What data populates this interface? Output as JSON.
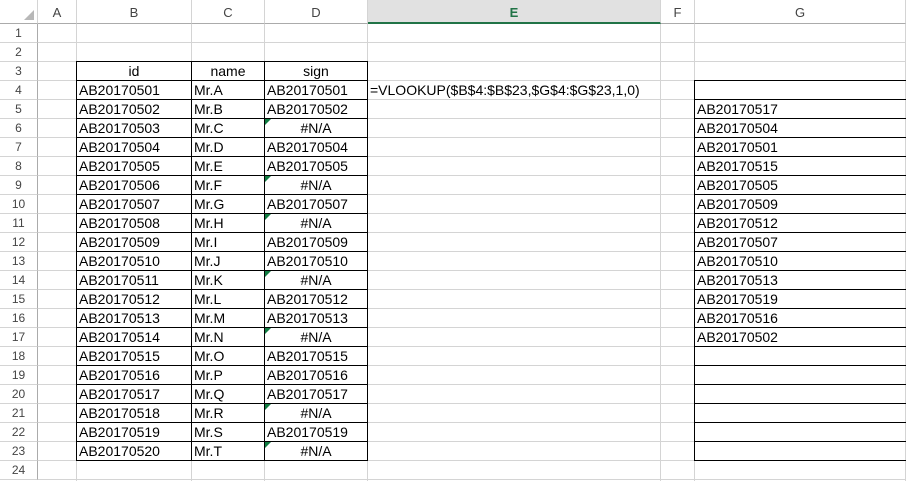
{
  "columns": [
    "A",
    "B",
    "C",
    "D",
    "E",
    "F",
    "G"
  ],
  "active_column": "E",
  "rows": [
    "1",
    "2",
    "3",
    "4",
    "5",
    "6",
    "7",
    "8",
    "9",
    "10",
    "11",
    "12",
    "13",
    "14",
    "15",
    "16",
    "17",
    "18",
    "19",
    "20",
    "21",
    "22",
    "23",
    "24"
  ],
  "table": {
    "headers": {
      "id": "id",
      "name": "name",
      "sign": "sign"
    },
    "data": [
      {
        "id": "AB20170501",
        "name": "Mr.A",
        "sign": "AB20170501",
        "err": false
      },
      {
        "id": "AB20170502",
        "name": "Mr.B",
        "sign": "AB20170502",
        "err": false
      },
      {
        "id": "AB20170503",
        "name": "Mr.C",
        "sign": "#N/A",
        "err": true
      },
      {
        "id": "AB20170504",
        "name": "Mr.D",
        "sign": "AB20170504",
        "err": false
      },
      {
        "id": "AB20170505",
        "name": "Mr.E",
        "sign": "AB20170505",
        "err": false
      },
      {
        "id": "AB20170506",
        "name": "Mr.F",
        "sign": "#N/A",
        "err": true
      },
      {
        "id": "AB20170507",
        "name": "Mr.G",
        "sign": "AB20170507",
        "err": false
      },
      {
        "id": "AB20170508",
        "name": "Mr.H",
        "sign": "#N/A",
        "err": true
      },
      {
        "id": "AB20170509",
        "name": "Mr.I",
        "sign": "AB20170509",
        "err": false
      },
      {
        "id": "AB20170510",
        "name": "Mr.J",
        "sign": "AB20170510",
        "err": false
      },
      {
        "id": "AB20170511",
        "name": "Mr.K",
        "sign": "#N/A",
        "err": true
      },
      {
        "id": "AB20170512",
        "name": "Mr.L",
        "sign": "AB20170512",
        "err": false
      },
      {
        "id": "AB20170513",
        "name": "Mr.M",
        "sign": "AB20170513",
        "err": false
      },
      {
        "id": "AB20170514",
        "name": "Mr.N",
        "sign": "#N/A",
        "err": true
      },
      {
        "id": "AB20170515",
        "name": "Mr.O",
        "sign": "AB20170515",
        "err": false
      },
      {
        "id": "AB20170516",
        "name": "Mr.P",
        "sign": "AB20170516",
        "err": false
      },
      {
        "id": "AB20170517",
        "name": "Mr.Q",
        "sign": "AB20170517",
        "err": false
      },
      {
        "id": "AB20170518",
        "name": "Mr.R",
        "sign": "#N/A",
        "err": true
      },
      {
        "id": "AB20170519",
        "name": "Mr.S",
        "sign": "AB20170519",
        "err": false
      },
      {
        "id": "AB20170520",
        "name": "Mr.T",
        "sign": "#N/A",
        "err": true
      }
    ]
  },
  "formula_text": "=VLOOKUP($B$4:$B$23,$G$4:$G$23,1,0)",
  "g_column": [
    "",
    "AB20170517",
    "AB20170504",
    "AB20170501",
    "AB20170515",
    "AB20170505",
    "AB20170509",
    "AB20170512",
    "AB20170507",
    "AB20170510",
    "AB20170513",
    "AB20170519",
    "AB20170516",
    "AB20170502",
    "",
    "",
    "",
    "",
    "",
    ""
  ],
  "colors": {
    "accent": "#217346",
    "error_indicator": "#107c41",
    "gridline": "#d4d4d4"
  }
}
